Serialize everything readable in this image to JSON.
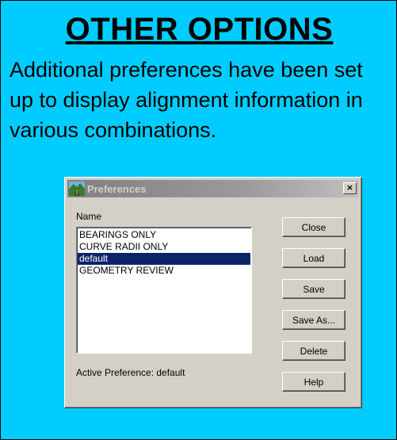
{
  "slide": {
    "title": "OTHER OPTIONS",
    "body": "Additional preferences have been set up to display alignment information in various combinations."
  },
  "dialog": {
    "title": "Preferences",
    "close_glyph": "×",
    "name_label": "Name",
    "preferences": [
      "BEARINGS ONLY",
      "CURVE RADII ONLY",
      "default",
      "GEOMETRY REVIEW"
    ],
    "selected": "default",
    "active_preference": "Active Preference: default",
    "buttons": {
      "close": "Close",
      "load": "Load",
      "save": "Save",
      "save_as": "Save As...",
      "delete": "Delete",
      "help": "Help"
    }
  },
  "colors": {
    "slide_background": "#00ccff",
    "selection": "#0a246a",
    "dialog_face": "#d4d0c8"
  },
  "icons": [
    "road-app-icon",
    "close-icon"
  ]
}
